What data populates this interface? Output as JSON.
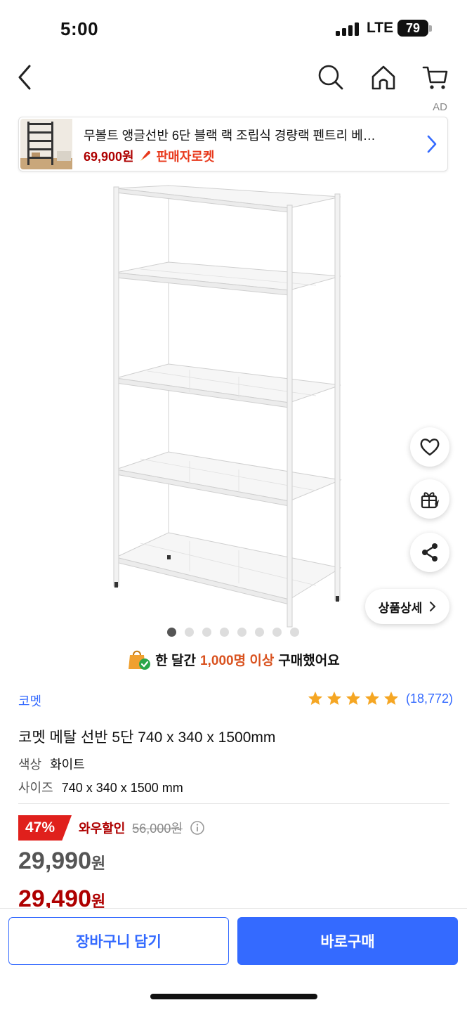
{
  "status_bar": {
    "time": "5:00",
    "network": "LTE",
    "battery": "79"
  },
  "ad": {
    "label": "AD",
    "title": "무볼트 앵글선반 6단 블랙 랙 조립식 경량랙 펜트리 베…",
    "price": "69,900원",
    "badge": "판매자로켓"
  },
  "gallery": {
    "total_images": 8,
    "current_index": 1
  },
  "floating": {
    "detail_label": "상품상세"
  },
  "purchase_note": {
    "prefix": "한 달간",
    "highlight": "1,000명 이상",
    "suffix": "구매했어요"
  },
  "product": {
    "brand": "코멧",
    "rating_stars": 5,
    "review_count": "(18,772)",
    "title": "코멧 메탈 선반 5단 740 x 340 x 1500mm",
    "options": [
      {
        "key": "색상",
        "value": "화이트"
      },
      {
        "key": "사이즈",
        "value": "740 x 340 x 1500 mm"
      }
    ],
    "discount_percent": "47%",
    "discount_label": "와우할인",
    "original_price": "56,000원",
    "price": "29,990",
    "price_unit": "원",
    "wow_price": "29,490",
    "wow_price_unit": "원"
  },
  "actions": {
    "cart": "장바구니 담기",
    "buy": "바로구매"
  },
  "colors": {
    "accent": "#346aff",
    "price_red": "#ae0000",
    "badge_red": "#e0201c",
    "rocket_orange": "#e8381b",
    "star": "#f5a623"
  }
}
